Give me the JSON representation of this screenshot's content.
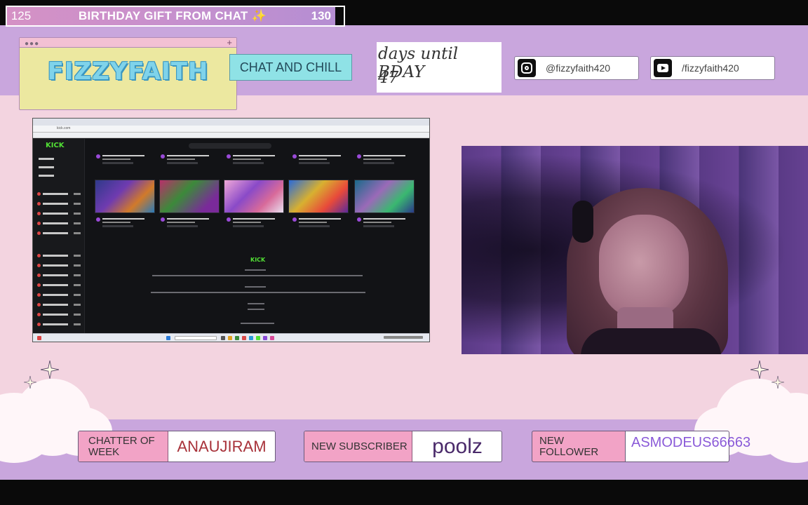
{
  "goal": {
    "current": "125",
    "title": "BIRTHDAY GIFT FROM CHAT ✨",
    "target": "130"
  },
  "logo": {
    "text": "FIZZYFAITH",
    "window_dots": "●●●",
    "plus": "+"
  },
  "tag": "CHAT AND CHILL",
  "countdown": {
    "label": "days until BDAY",
    "days": "47"
  },
  "socials": {
    "instagram": "@fizzyfaith420",
    "youtube": "/fizzyfaith420"
  },
  "capture": {
    "url": "kick.com",
    "brand": "KICK",
    "footer_brand": "KICK"
  },
  "widgets": {
    "chatter": {
      "label": "CHATTER OF WEEK",
      "value": "ANAUJIRAM"
    },
    "subscriber": {
      "label": "NEW SUBSCRIBER",
      "value": "poolz"
    },
    "follower": {
      "label": "NEW FOLLOWER",
      "value": "ASMODEUS66663"
    }
  },
  "colors": {
    "pink_bg": "#f3d4e0",
    "purple": "#c9a6dd",
    "label_pink": "#f2a3c6",
    "teal": "#8fe2e6",
    "kick_green": "#52e035"
  }
}
